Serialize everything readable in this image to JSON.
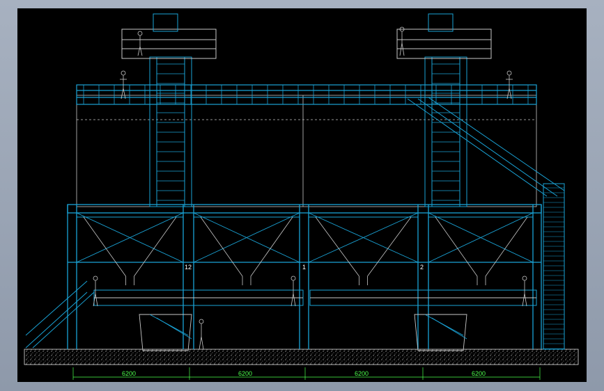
{
  "colors": {
    "background": "#000000",
    "frame": "#a7b1c0",
    "structure": "#1aa3d6",
    "steel": "#c8c8c8",
    "dimension": "#4cff4c",
    "ground": "#e0e0e0"
  },
  "dimensions": [
    "6200",
    "6200",
    "6200",
    "6200"
  ],
  "grid_labels": [
    "12",
    "1",
    "2"
  ]
}
